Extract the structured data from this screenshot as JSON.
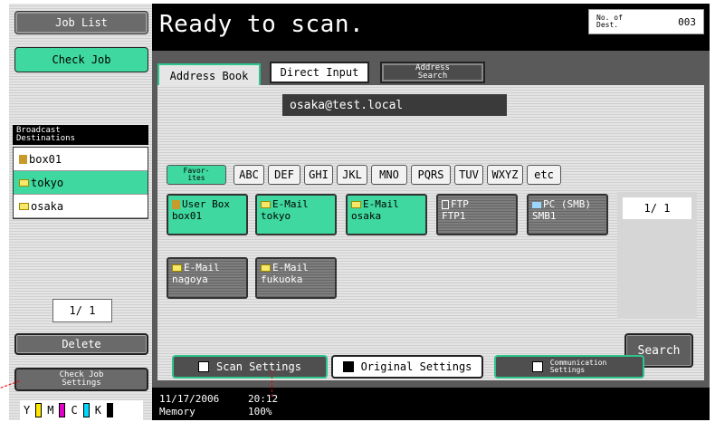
{
  "left": {
    "job_list": "Job List",
    "check_job": "Check Job",
    "broadcast_title": "Broadcast\nDestinations",
    "destinations": [
      {
        "label": "box01",
        "icon": "user-box-icon",
        "selected": false
      },
      {
        "label": "tokyo",
        "icon": "mail-icon",
        "selected": true
      },
      {
        "label": "osaka",
        "icon": "mail-icon",
        "selected": false
      }
    ],
    "page": "1/ 1",
    "delete": "Delete",
    "check_job_settings": "Check Job\nSettings",
    "toner": [
      "Y",
      "M",
      "C",
      "K"
    ]
  },
  "header": {
    "title": "Ready to scan.",
    "dest_label": "No. of\nDest.",
    "dest_count": "003"
  },
  "tabs": {
    "address_book": "Address Book",
    "direct_input": "Direct Input",
    "address_search": "Address\nSearch"
  },
  "address_field": "osaka@test.local",
  "keys": [
    "Favor-\nites",
    "ABC",
    "DEF",
    "GHI",
    "JKL",
    "MNO",
    "PQRS",
    "TUV",
    "WXYZ",
    "etc"
  ],
  "tiles": [
    {
      "type": "User Box",
      "name": "box01",
      "icon": "user-box-icon",
      "selected": true
    },
    {
      "type": "E-Mail",
      "name": "tokyo",
      "icon": "mail-icon",
      "selected": true
    },
    {
      "type": "E-Mail",
      "name": "osaka",
      "icon": "mail-icon",
      "selected": true
    },
    {
      "type": "FTP",
      "name": "FTP1",
      "icon": "ftp-icon",
      "selected": false
    },
    {
      "type": "PC (SMB)",
      "name": "SMB1",
      "icon": "pc-icon",
      "selected": false
    },
    {
      "type": "E-Mail",
      "name": "nagoya",
      "icon": "mail-icon",
      "selected": false
    },
    {
      "type": "E-Mail",
      "name": "fukuoka",
      "icon": "mail-icon",
      "selected": false
    }
  ],
  "list_page": "1/ 1",
  "search": "Search",
  "bottom": {
    "scan_settings": "Scan Settings",
    "original_settings": "Original Settings",
    "communication_settings": "Communication\nSettings"
  },
  "status": {
    "date": "11/17/2006",
    "time": "20:12",
    "memory_label": "Memory",
    "memory_value": "100%"
  }
}
